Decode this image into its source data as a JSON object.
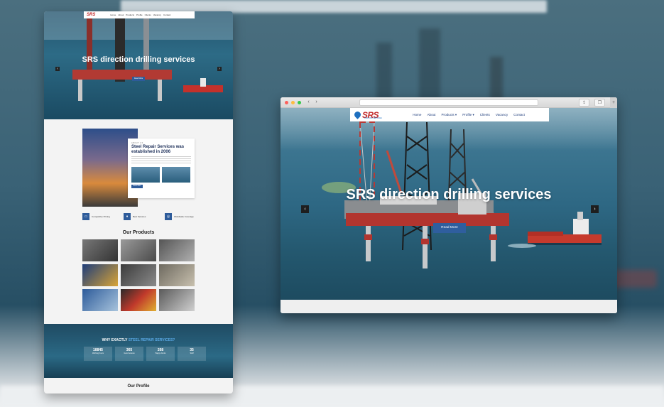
{
  "left_page": {
    "logo": "SRS",
    "nav": [
      "Home",
      "About",
      "Products",
      "Profile",
      "Clients",
      "Vacancy",
      "Contact"
    ],
    "hero_title": "SRS direction drilling services",
    "hero_button": "Read More",
    "about": {
      "eyebrow": "ABOUT US",
      "heading": "Steel Repair Services was established in 2006",
      "button": "Read More"
    },
    "features": [
      {
        "icon": "pricing-icon",
        "label": "Competitive Pricing"
      },
      {
        "icon": "service-icon",
        "label": "Best Services"
      },
      {
        "icon": "globe-icon",
        "label": "Worldwide Coverage"
      }
    ],
    "products_title": "Our Products",
    "why": {
      "prefix": "WHY EXACTLY",
      "highlight": "STEEL REPAIR SERVICES?"
    },
    "stats": [
      {
        "value": "18845",
        "label": "Working hours"
      },
      {
        "value": "365",
        "label": "Good reviews"
      },
      {
        "value": "268",
        "label": "Happy clients"
      },
      {
        "value": "35",
        "label": "Staff"
      }
    ],
    "profile_title": "Our Profile"
  },
  "browser": {
    "logo": "SRS",
    "logo_sub": "DRILLING SERVICES",
    "nav": {
      "home": "Home",
      "about": "About",
      "products": "Products ▾",
      "profile": "Profile ▾",
      "clients": "Clients",
      "vacancy": "Vacancy",
      "contact": "Contact"
    },
    "hero_title": "SRS direction drilling services",
    "read_more": "Read More",
    "prev_arrow": "‹",
    "next_arrow": "›"
  },
  "colors": {
    "brand_red": "#c42d2d",
    "brand_blue": "#2f5e9e",
    "nav_text": "#1c3b7a"
  }
}
